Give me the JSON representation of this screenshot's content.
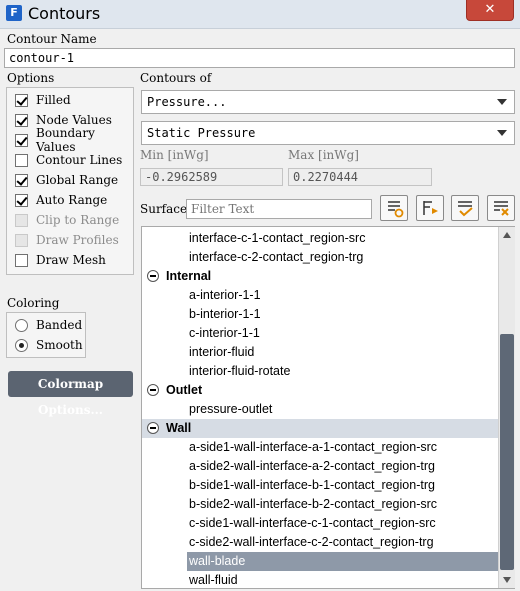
{
  "window": {
    "title": "Contours",
    "app_icon": "F",
    "close_glyph": "✕"
  },
  "contour_name": {
    "label": "Contour Name",
    "value": "contour-1"
  },
  "options": {
    "label": "Options",
    "items": [
      {
        "label": "Filled",
        "checked": true,
        "enabled": true
      },
      {
        "label": "Node Values",
        "checked": true,
        "enabled": true
      },
      {
        "label": "Boundary Values",
        "checked": true,
        "enabled": true
      },
      {
        "label": "Contour Lines",
        "checked": false,
        "enabled": true
      },
      {
        "label": "Global Range",
        "checked": true,
        "enabled": true
      },
      {
        "label": "Auto Range",
        "checked": true,
        "enabled": true
      },
      {
        "label": "Clip to Range",
        "checked": false,
        "enabled": false
      },
      {
        "label": "Draw Profiles",
        "checked": false,
        "enabled": false
      },
      {
        "label": "Draw Mesh",
        "checked": false,
        "enabled": true
      }
    ]
  },
  "coloring": {
    "label": "Coloring",
    "items": [
      {
        "label": "Banded",
        "selected": false
      },
      {
        "label": "Smooth",
        "selected": true
      }
    ]
  },
  "colormap_button": "Colormap Options...",
  "contours_of": {
    "label": "Contours of",
    "category": "Pressure...",
    "quantity": "Static Pressure"
  },
  "range": {
    "min_label": "Min [inWg]",
    "min_value": "-0.2962589",
    "max_label": "Max [inWg]",
    "max_value": "0.2270444"
  },
  "surfaces": {
    "label": "Surfaces",
    "filter_placeholder": "Filter Text",
    "tools": [
      "filter-surface-icon",
      "filter-replace-icon",
      "select-all-icon",
      "deselect-all-icon"
    ],
    "rows": [
      {
        "kind": "item",
        "text": "interface-c-1-contact_region-src"
      },
      {
        "kind": "item",
        "text": "interface-c-2-contact_region-trg"
      },
      {
        "kind": "group",
        "text": "Internal"
      },
      {
        "kind": "item",
        "text": "a-interior-1-1"
      },
      {
        "kind": "item",
        "text": "b-interior-1-1"
      },
      {
        "kind": "item",
        "text": "c-interior-1-1"
      },
      {
        "kind": "item",
        "text": "interior-fluid"
      },
      {
        "kind": "item",
        "text": "interior-fluid-rotate"
      },
      {
        "kind": "group",
        "text": "Outlet"
      },
      {
        "kind": "item",
        "text": "pressure-outlet"
      },
      {
        "kind": "group",
        "text": "Wall",
        "highlighted": true
      },
      {
        "kind": "item",
        "text": "a-side1-wall-interface-a-1-contact_region-src"
      },
      {
        "kind": "item",
        "text": "a-side2-wall-interface-a-2-contact_region-trg"
      },
      {
        "kind": "item",
        "text": "b-side1-wall-interface-b-1-contact_region-trg"
      },
      {
        "kind": "item",
        "text": "b-side2-wall-interface-b-2-contact_region-src"
      },
      {
        "kind": "item",
        "text": "c-side1-wall-interface-c-1-contact_region-src"
      },
      {
        "kind": "item",
        "text": "c-side2-wall-interface-c-2-contact_region-trg"
      },
      {
        "kind": "item",
        "text": "wall-blade",
        "selected": true
      },
      {
        "kind": "item",
        "text": "wall-fluid"
      }
    ]
  },
  "colors": {
    "selection": "#8e99a8",
    "group_highlight": "#d6dce4",
    "button_dark": "#5b6471",
    "close_red": "#c7483a"
  }
}
